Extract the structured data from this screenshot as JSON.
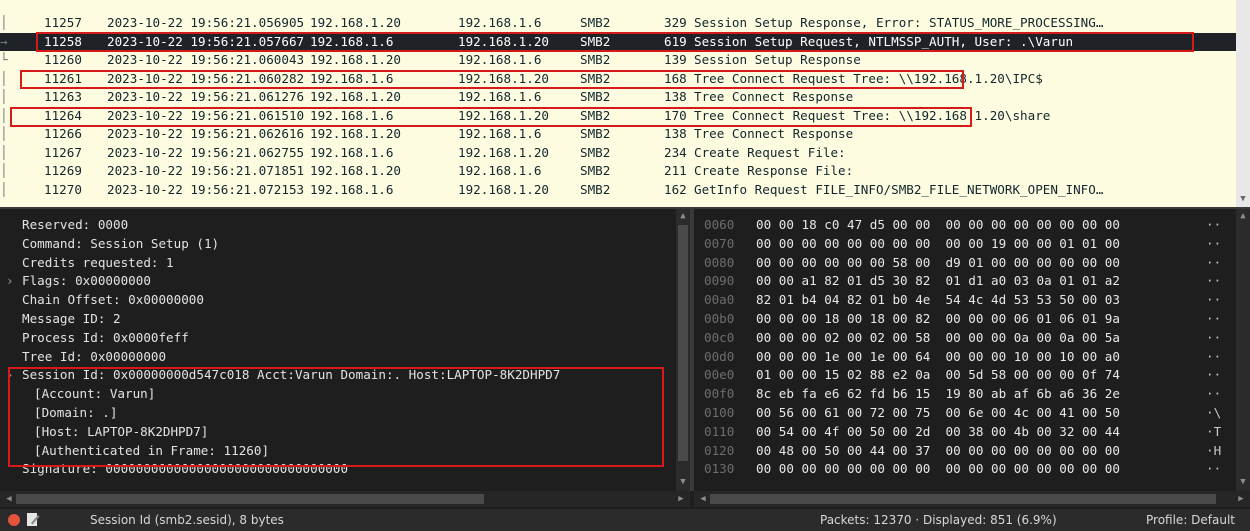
{
  "packets": [
    {
      "tree": "│",
      "no": "11257",
      "time": "2023-10-22 19:56:21.056905",
      "src": "192.168.1.20",
      "dst": "192.168.1.6",
      "proto": "SMB2",
      "len": "329",
      "info": "Session Setup Response, Error: STATUS_MORE_PROCESSING…",
      "selected": false
    },
    {
      "tree": "→",
      "no": "11258",
      "time": "2023-10-22 19:56:21.057667",
      "src": "192.168.1.6",
      "dst": "192.168.1.20",
      "proto": "SMB2",
      "len": "619",
      "info": "Session Setup Request, NTLMSSP_AUTH, User: .\\Varun",
      "selected": true
    },
    {
      "tree": "└",
      "no": "11260",
      "time": "2023-10-22 19:56:21.060043",
      "src": "192.168.1.20",
      "dst": "192.168.1.6",
      "proto": "SMB2",
      "len": "139",
      "info": "Session Setup Response",
      "selected": false
    },
    {
      "tree": "│",
      "no": "11261",
      "time": "2023-10-22 19:56:21.060282",
      "src": "192.168.1.6",
      "dst": "192.168.1.20",
      "proto": "SMB2",
      "len": "168",
      "info": "Tree Connect Request Tree: \\\\192.168.1.20\\IPC$",
      "selected": false
    },
    {
      "tree": "│",
      "no": "11263",
      "time": "2023-10-22 19:56:21.061276",
      "src": "192.168.1.20",
      "dst": "192.168.1.6",
      "proto": "SMB2",
      "len": "138",
      "info": "Tree Connect Response",
      "selected": false
    },
    {
      "tree": "│",
      "no": "11264",
      "time": "2023-10-22 19:56:21.061510",
      "src": "192.168.1.6",
      "dst": "192.168.1.20",
      "proto": "SMB2",
      "len": "170",
      "info": "Tree Connect Request Tree: \\\\192.168.1.20\\share",
      "selected": false
    },
    {
      "tree": "│",
      "no": "11266",
      "time": "2023-10-22 19:56:21.062616",
      "src": "192.168.1.20",
      "dst": "192.168.1.6",
      "proto": "SMB2",
      "len": "138",
      "info": "Tree Connect Response",
      "selected": false
    },
    {
      "tree": "│",
      "no": "11267",
      "time": "2023-10-22 19:56:21.062755",
      "src": "192.168.1.6",
      "dst": "192.168.1.20",
      "proto": "SMB2",
      "len": "234",
      "info": "Create Request File:",
      "selected": false
    },
    {
      "tree": "│",
      "no": "11269",
      "time": "2023-10-22 19:56:21.071851",
      "src": "192.168.1.20",
      "dst": "192.168.1.6",
      "proto": "SMB2",
      "len": "211",
      "info": "Create Response File:",
      "selected": false
    },
    {
      "tree": "│",
      "no": "11270",
      "time": "2023-10-22 19:56:21.072153",
      "src": "192.168.1.6",
      "dst": "192.168.1.20",
      "proto": "SMB2",
      "len": "162",
      "info": "GetInfo Request FILE_INFO/SMB2_FILE_NETWORK_OPEN_INFO…",
      "selected": false
    }
  ],
  "details": [
    {
      "text": "Reserved: 0000",
      "indent": 0
    },
    {
      "text": "Command: Session Setup (1)",
      "indent": 0
    },
    {
      "text": "Credits requested: 1",
      "indent": 0
    },
    {
      "text": "Flags: 0x00000000",
      "indent": 0,
      "expander": true
    },
    {
      "text": "Chain Offset: 0x00000000",
      "indent": 0
    },
    {
      "text": "Message ID: 2",
      "indent": 0
    },
    {
      "text": "Process Id: 0x0000feff",
      "indent": 0
    },
    {
      "text": "Tree Id: 0x00000000",
      "indent": 0
    },
    {
      "text": "Session Id: 0x00000000d547c018 Acct:Varun Domain:. Host:LAPTOP-8K2DHPD7",
      "indent": 0,
      "expander": true
    },
    {
      "text": "[Account: Varun]",
      "indent": 1
    },
    {
      "text": "[Domain: .]",
      "indent": 1
    },
    {
      "text": "[Host: LAPTOP-8K2DHPD7]",
      "indent": 1
    },
    {
      "text": "[Authenticated in Frame: 11260]",
      "indent": 1
    },
    {
      "text": "Signature: 00000000000000000000000000000000",
      "indent": 0
    }
  ],
  "bytes": [
    {
      "off": "0060",
      "hex": "00 00 18 c0 47 d5 00 00  00 00 00 00 00 00 00 00",
      "ascii": "··"
    },
    {
      "off": "0070",
      "hex": "00 00 00 00 00 00 00 00  00 00 19 00 00 01 01 00",
      "ascii": "··"
    },
    {
      "off": "0080",
      "hex": "00 00 00 00 00 00 58 00  d9 01 00 00 00 00 00 00",
      "ascii": "··"
    },
    {
      "off": "0090",
      "hex": "00 00 a1 82 01 d5 30 82  01 d1 a0 03 0a 01 01 a2",
      "ascii": "··"
    },
    {
      "off": "00a0",
      "hex": "82 01 b4 04 82 01 b0 4e  54 4c 4d 53 53 50 00 03",
      "ascii": "··"
    },
    {
      "off": "00b0",
      "hex": "00 00 00 18 00 18 00 82  00 00 00 06 01 06 01 9a",
      "ascii": "··"
    },
    {
      "off": "00c0",
      "hex": "00 00 00 02 00 02 00 58  00 00 00 0a 00 0a 00 5a",
      "ascii": "··"
    },
    {
      "off": "00d0",
      "hex": "00 00 00 1e 00 1e 00 64  00 00 00 10 00 10 00 a0",
      "ascii": "··"
    },
    {
      "off": "00e0",
      "hex": "01 00 00 15 02 88 e2 0a  00 5d 58 00 00 00 0f 74",
      "ascii": "··"
    },
    {
      "off": "00f0",
      "hex": "8c eb fa e6 62 fd b6 15  19 80 ab af 6b a6 36 2e",
      "ascii": "··"
    },
    {
      "off": "0100",
      "hex": "00 56 00 61 00 72 00 75  00 6e 00 4c 00 41 00 50",
      "ascii": "·\\"
    },
    {
      "off": "0110",
      "hex": "00 54 00 4f 00 50 00 2d  00 38 00 4b 00 32 00 44",
      "ascii": "·T"
    },
    {
      "off": "0120",
      "hex": "00 48 00 50 00 44 00 37  00 00 00 00 00 00 00 00",
      "ascii": "·H"
    },
    {
      "off": "0130",
      "hex": "00 00 00 00 00 00 00 00  00 00 00 00 00 00 00 00",
      "ascii": "··"
    }
  ],
  "status": {
    "field_info": "Session Id (smb2.sesid), 8 bytes",
    "packets": "Packets: 12370 · Displayed: 851 (6.9%)",
    "profile": "Profile: Default"
  },
  "colors": {
    "row_bg": "#fdfce0",
    "selected_bg": "#1f2327",
    "highlight": "#d61a1a"
  }
}
